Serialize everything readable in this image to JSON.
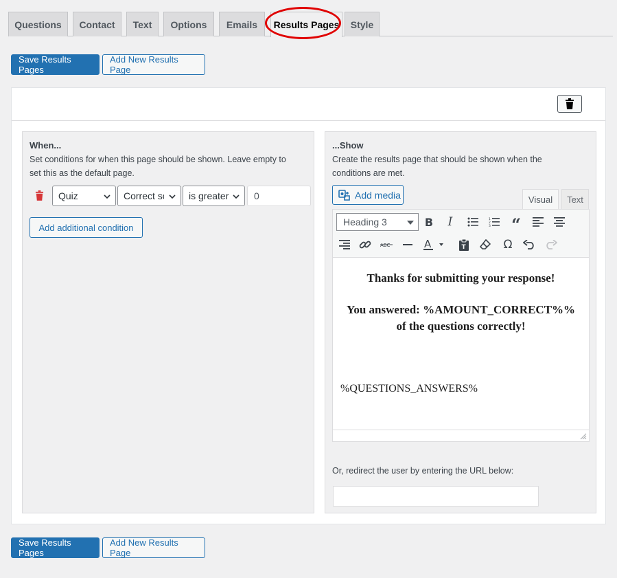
{
  "tabs": [
    "Questions",
    "Contact",
    "Text",
    "Options",
    "Emails",
    "Results Pages",
    "Style"
  ],
  "active_tab": "Results Pages",
  "actions": {
    "save_label": "Save Results Pages",
    "add_label": "Add New Results Page"
  },
  "when": {
    "title": "When...",
    "desc_line1": "Set conditions for when this page should be shown. Leave empty to",
    "desc_line2": "set this as the default page.",
    "condition": {
      "category": "Quiz",
      "metric": "Correct score",
      "operator": "is greater",
      "value": "0"
    },
    "add_condition_label": "Add additional condition"
  },
  "show": {
    "title": "...Show",
    "desc_line1": "Create the results page that should be shown when the",
    "desc_line2": "conditions are met.",
    "add_media_label": "Add media",
    "tab_visual": "Visual",
    "tab_text": "Text",
    "format": "Heading 3",
    "content": {
      "line1": "Thanks for submitting your response!",
      "line2": "You answered: %AMOUNT_CORRECT%%",
      "line3": "of the questions correctly!",
      "line4": "%QUESTIONS_ANSWERS%"
    },
    "redirect_label": "Or, redirect the user by entering the URL below:",
    "redirect_value": ""
  },
  "colors": {
    "primary": "#2271b1",
    "danger": "#d63638",
    "highlight": "#e00000"
  }
}
